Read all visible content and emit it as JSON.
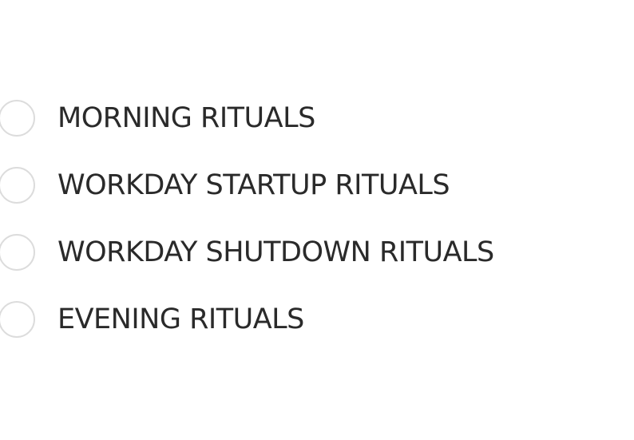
{
  "rituals": [
    {
      "label": "MORNING RITUALS",
      "selected": false
    },
    {
      "label": "WORKDAY STARTUP RITUALS",
      "selected": false
    },
    {
      "label": "WORKDAY SHUTDOWN RITUALS",
      "selected": false
    },
    {
      "label": "EVENING RITUALS",
      "selected": false
    }
  ],
  "colors": {
    "text": "#2a2a2a",
    "radio_border": "#dcdcdc",
    "background": "#ffffff"
  }
}
